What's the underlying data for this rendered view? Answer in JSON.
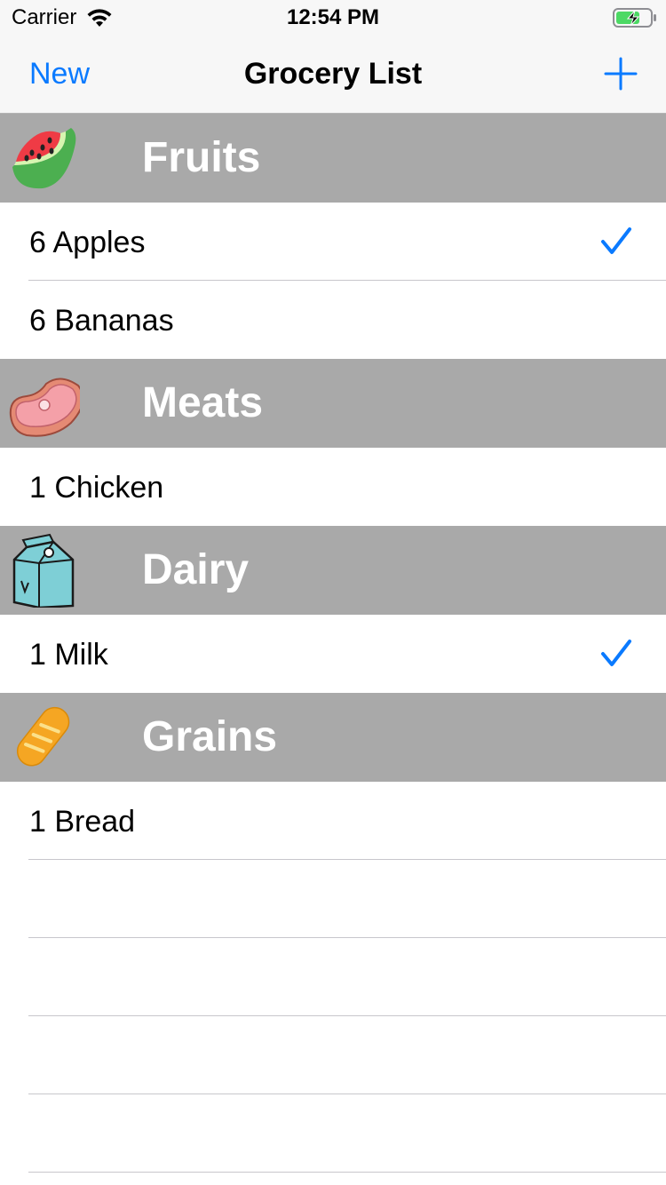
{
  "status_bar": {
    "carrier": "Carrier",
    "time": "12:54 PM",
    "battery_color": "#4cd964"
  },
  "nav": {
    "left_button": "New",
    "title": "Grocery List",
    "add_icon": "plus-icon",
    "accent": "#0a7aff"
  },
  "sections": [
    {
      "title": "Fruits",
      "icon": "watermelon-icon",
      "items": [
        {
          "label": "6 Apples",
          "checked": true
        },
        {
          "label": "6 Bananas",
          "checked": false
        }
      ]
    },
    {
      "title": "Meats",
      "icon": "steak-icon",
      "items": [
        {
          "label": "1 Chicken",
          "checked": false
        }
      ]
    },
    {
      "title": "Dairy",
      "icon": "milk-carton-icon",
      "items": [
        {
          "label": "1 Milk",
          "checked": true
        }
      ]
    },
    {
      "title": "Grains",
      "icon": "bread-icon",
      "items": [
        {
          "label": "1 Bread",
          "checked": false
        }
      ]
    }
  ]
}
